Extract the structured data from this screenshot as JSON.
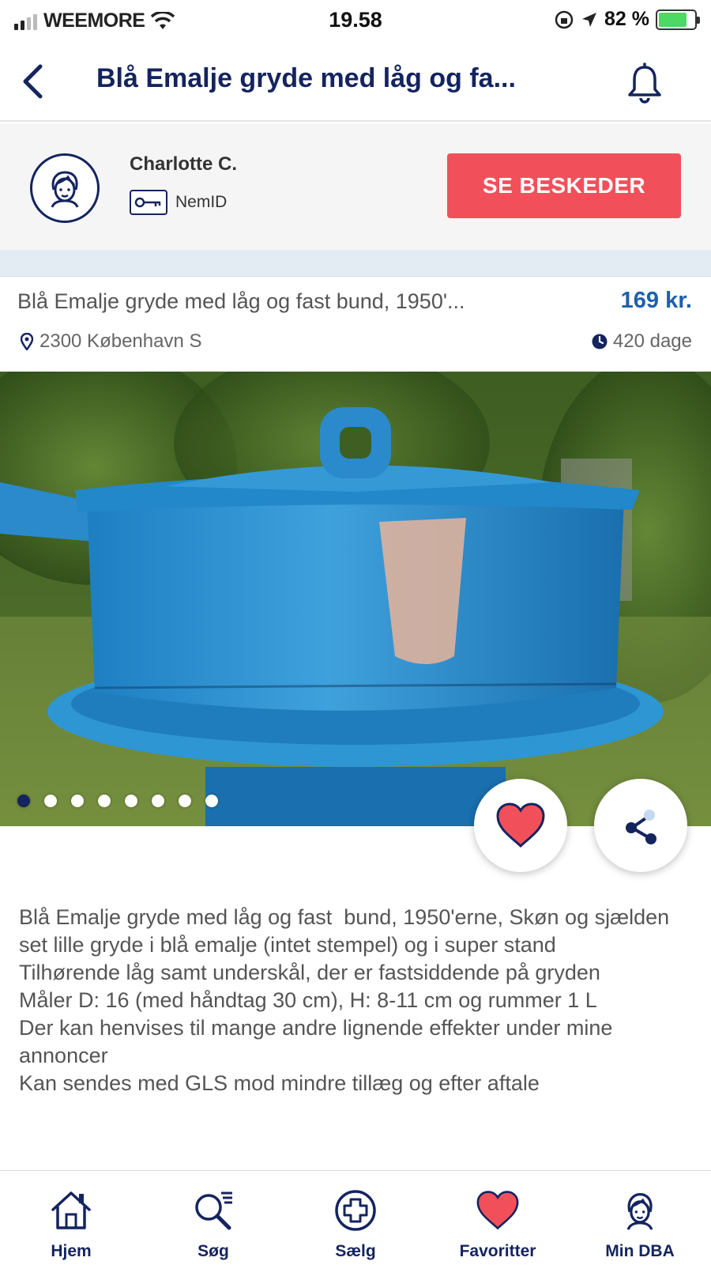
{
  "status_bar": {
    "carrier": "WEEMORE",
    "time": "19.58",
    "battery": "82 %"
  },
  "nav": {
    "title": "Blå Emalje gryde med låg og fa..."
  },
  "seller": {
    "name": "Charlotte C.",
    "verification": "NemID",
    "messages_button": "SE BESKEDER"
  },
  "listing": {
    "title": "Blå Emalje gryde med låg og fast  bund, 1950'...",
    "price": "169 kr.",
    "location": "2300 København S",
    "age": "420 dage",
    "image_count": 8,
    "active_image": 1
  },
  "description": {
    "lines": [
      "Blå Emalje gryde med låg og fast  bund, 1950'erne, Skøn og sjælden set lille gryde i blå emalje (intet stempel) og i super stand",
      "Tilhørende låg samt underskål, der er fastsiddende på gryden",
      "Måler D: 16 (med håndtag 30 cm), H: 8-11 cm og rummer 1 L",
      "Der kan henvises til mange andre lignende effekter under mine annoncer",
      "Kan sendes med GLS mod mindre tillæg og efter aftale"
    ]
  },
  "tabs": [
    {
      "label": "Hjem",
      "icon": "home-icon"
    },
    {
      "label": "Søg",
      "icon": "search-icon"
    },
    {
      "label": "Sælg",
      "icon": "plus-circle-icon"
    },
    {
      "label": "Favoritter",
      "icon": "heart-icon"
    },
    {
      "label": "Min DBA",
      "icon": "profile-icon"
    }
  ],
  "colors": {
    "brand_navy": "#14245f",
    "cta_red": "#f1505b",
    "price_blue": "#1f5fae",
    "heart_red": "#f1505b"
  }
}
